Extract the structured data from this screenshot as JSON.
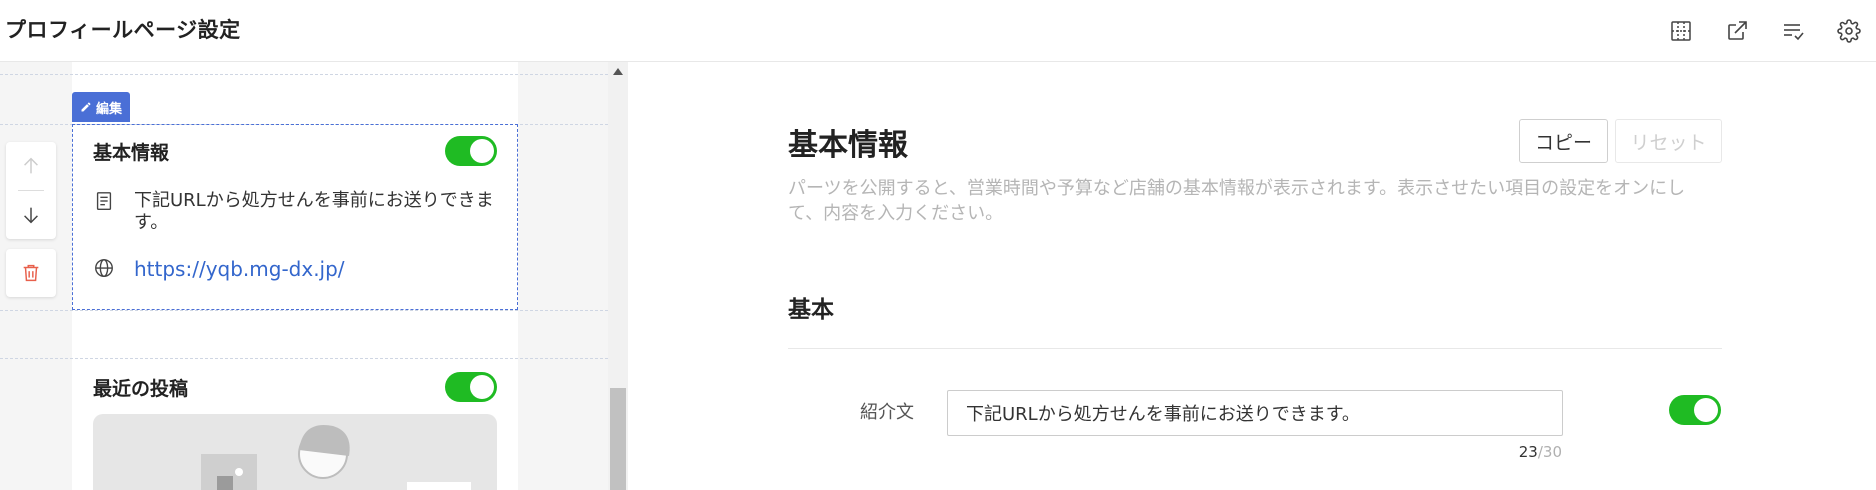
{
  "header": {
    "title": "プロフィールページ設定",
    "actions": [
      {
        "icon": "grid-layout-icon"
      },
      {
        "icon": "external-link-icon"
      },
      {
        "icon": "checklist-icon"
      },
      {
        "icon": "gear-icon"
      }
    ]
  },
  "preview": {
    "edit_label": "編集",
    "basic_card": {
      "title": "基本情報",
      "enabled": true,
      "description": "下記URLから処方せんを事前にお送りできます。",
      "url": "https://yqb.mg-dx.jp/"
    },
    "recent_posts_card": {
      "title": "最近の投稿",
      "enabled": true
    }
  },
  "settings": {
    "section_title": "基本情報",
    "section_desc": "パーツを公開すると、営業時間や予算など店舗の基本情報が表示されます。表示させたい項目の設定をオンにして、内容を入力ください。",
    "copy_label": "コピー",
    "reset_label": "リセット",
    "subsection_title": "基本",
    "intro_field": {
      "label": "紹介文",
      "value": "下記URLから処方せんを事前にお送りできます。",
      "count": "23",
      "max": "/30",
      "enabled": true
    }
  },
  "colors": {
    "accent": "#4a6fd6",
    "toggle_on": "#1fbb23",
    "link": "#3366cc"
  }
}
